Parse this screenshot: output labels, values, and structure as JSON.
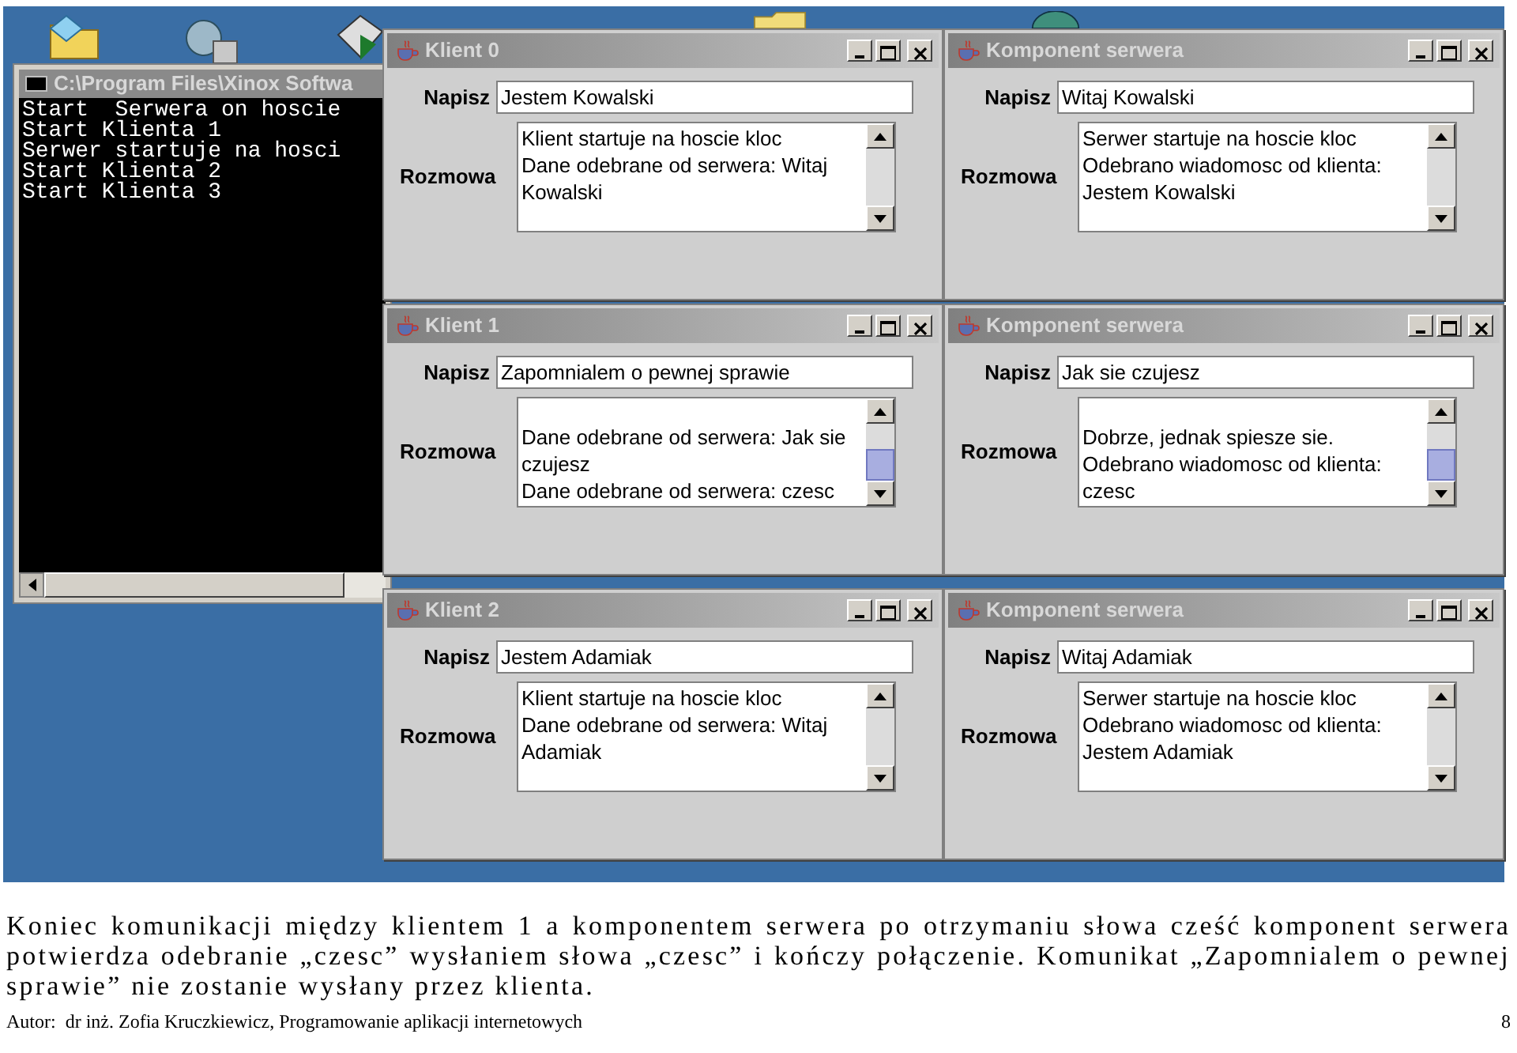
{
  "console": {
    "title": "C:\\Program Files\\Xinox Softwa",
    "lines": [
      "Start  Serwera on hoscie",
      "Start Klienta 1",
      "Serwer startuje na hosci",
      "Start Klienta 2",
      "Start Klienta 3"
    ]
  },
  "windows": [
    {
      "title": "Klient 0",
      "input_label": "Napisz",
      "input_value": "Jestem Kowalski",
      "log_label": "Rozmowa",
      "scrolled": false,
      "messages": [
        "Klient startuje na hoscie kloc",
        "Dane odebrane od serwera: Witaj Kowalski"
      ]
    },
    {
      "title": "Komponent serwera",
      "input_label": "Napisz",
      "input_value": "Witaj Kowalski",
      "log_label": "Rozmowa",
      "scrolled": false,
      "messages": [
        "Serwer startuje na hoscie kloc",
        "Odebrano wiadomosc od klienta: Jestem Kowalski"
      ]
    },
    {
      "title": "Klient 1",
      "input_label": "Napisz",
      "input_value": "Zapomnialem o pewnej sprawie",
      "log_label": "Rozmowa",
      "scrolled": true,
      "messages": [
        "Dane odebrane od serwera: Jak sie czujesz",
        "Dane odebrane od serwera: czesc"
      ]
    },
    {
      "title": "Komponent serwera",
      "input_label": "Napisz",
      "input_value": "Jak sie czujesz",
      "log_label": "Rozmowa",
      "scrolled": true,
      "messages": [
        "Dobrze, jednak spiesze sie.",
        "Odebrano wiadomosc od klienta: czesc"
      ]
    },
    {
      "title": "Klient 2",
      "input_label": "Napisz",
      "input_value": "Jestem Adamiak",
      "log_label": "Rozmowa",
      "scrolled": false,
      "messages": [
        "Klient startuje na hoscie kloc",
        "Dane odebrane od serwera: Witaj Adamiak"
      ]
    },
    {
      "title": "Komponent serwera",
      "input_label": "Napisz",
      "input_value": "Witaj Adamiak",
      "log_label": "Rozmowa",
      "scrolled": false,
      "messages": [
        "Serwer startuje na hoscie kloc",
        "Odebrano wiadomosc od klienta: Jestem Adamiak"
      ]
    }
  ],
  "caption": "Koniec komunikacji między klientem 1 a komponentem serwera po otrzymaniu słowa cześć komponent serwera potwierdza odebranie „czesc” wysłaniem słowa „czesc” i kończy połączenie. Komunikat „Zapomnialem o pewnej sprawie” nie zostanie wysłany przez klienta.",
  "footer": {
    "author": "Autor:  dr inż. Zofia Kruczkiewicz, Programowanie aplikacji internetowych",
    "page": "8"
  }
}
